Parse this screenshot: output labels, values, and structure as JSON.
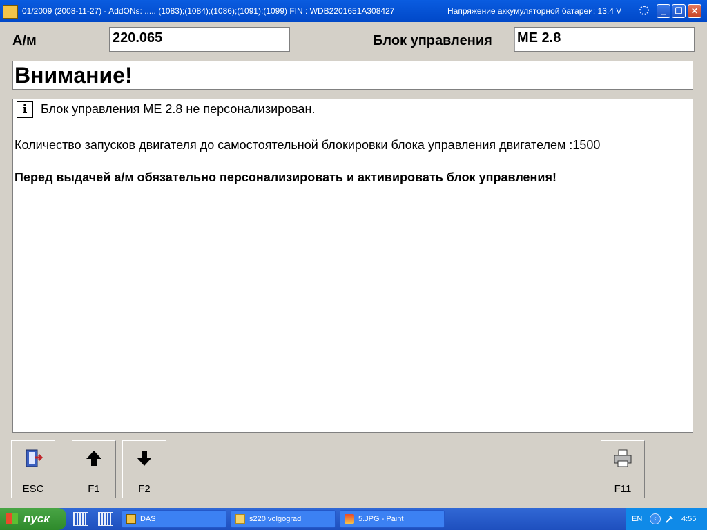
{
  "window": {
    "title": "01/2009 (2008-11-27) - AddONs: ..... (1083);(1084);(1086);(1091);(1099)  FIN : WDB2201651A308427",
    "voltage": "Напряжение аккумуляторной батареи: 13.4 V",
    "min_label": "_",
    "max_label": "❐",
    "close_label": "✕"
  },
  "header": {
    "vehicle_label": "А/м",
    "vehicle_value": "220.065",
    "ecu_label": "Блок управления",
    "ecu_value": "ME 2.8"
  },
  "warning_title": "Внимание!",
  "content": {
    "info_glyph": "i",
    "line1": "Блок управления ME 2.8 не персонализирован.",
    "line2": "Количество запусков двигателя до самостоятельной блокировки блока управления двигателем :1500",
    "line3": "Перед выдачей а/м обязательно персонализировать и активировать блок управления!"
  },
  "buttons": {
    "esc": {
      "label": "ESC",
      "icon": "exit-door-icon"
    },
    "f1": {
      "label": "F1",
      "icon": "arrow-up-icon"
    },
    "f2": {
      "label": "F2",
      "icon": "arrow-down-icon"
    },
    "f11": {
      "label": "F11",
      "icon": "printer-icon"
    }
  },
  "taskbar": {
    "start_label": "пуск",
    "tasks": [
      {
        "label": "DAS",
        "icon": "das-icon"
      },
      {
        "label": "s220 volgograd",
        "icon": "folder-icon"
      },
      {
        "label": "5.JPG - Paint",
        "icon": "paint-icon"
      }
    ],
    "language": "EN",
    "clock": "4:55"
  }
}
